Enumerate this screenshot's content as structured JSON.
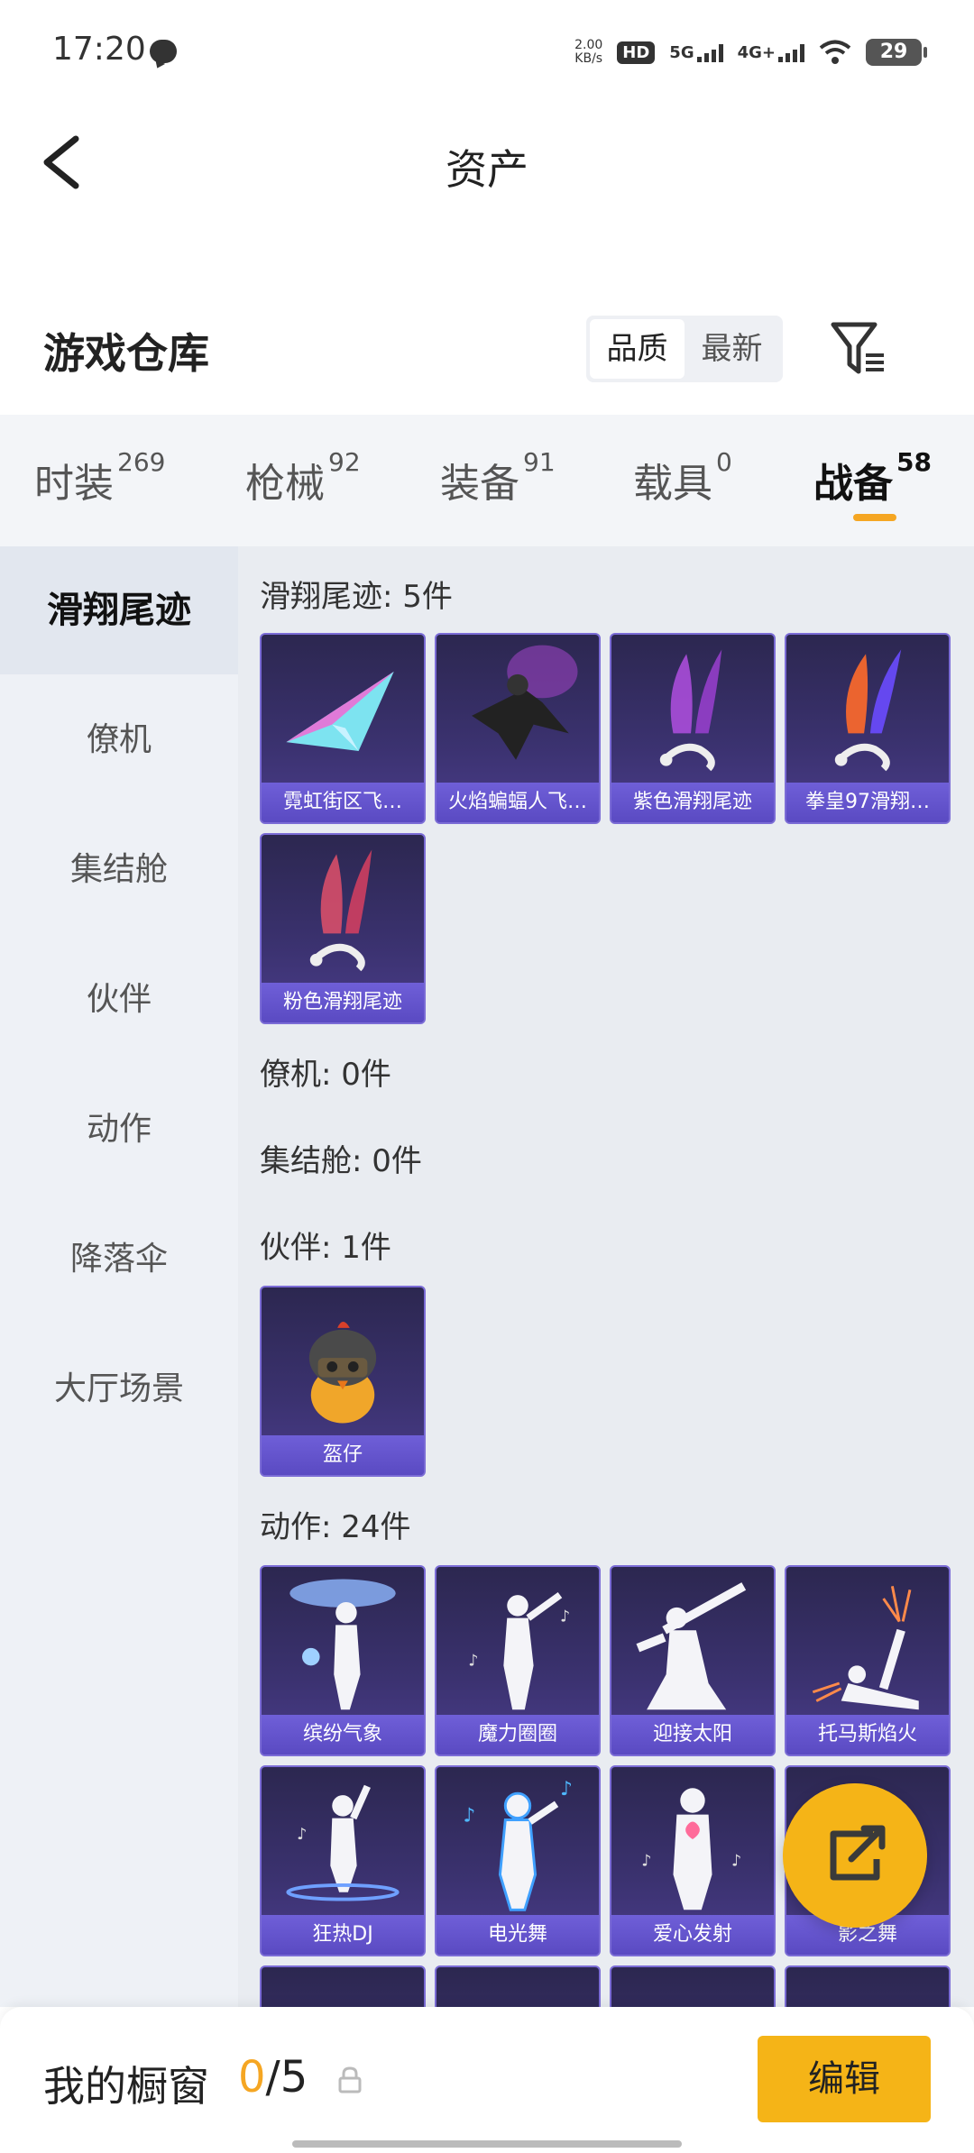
{
  "status_bar": {
    "time": "17:20",
    "speed_value": "2.00",
    "speed_unit": "KB/s",
    "hd": "HD",
    "net1": "5G",
    "net2": "4G+",
    "battery": "29"
  },
  "header": {
    "title": "资产"
  },
  "warehouse": {
    "title": "游戏仓库",
    "sort_options": [
      "品质",
      "最新"
    ],
    "sort_active": "品质"
  },
  "tabs": [
    {
      "label": "时装",
      "count": "269"
    },
    {
      "label": "枪械",
      "count": "92"
    },
    {
      "label": "装备",
      "count": "91"
    },
    {
      "label": "载具",
      "count": "0"
    },
    {
      "label": "战备",
      "count": "58",
      "active": true
    }
  ],
  "sidebar": {
    "items": [
      "滑翔尾迹",
      "僚机",
      "集结舱",
      "伙伴",
      "动作",
      "降落伞",
      "大厅场景"
    ],
    "active": "滑翔尾迹"
  },
  "sections": {
    "glide": {
      "title": "滑翔尾迹: 5件",
      "items": [
        "霓虹街区飞…",
        "火焰蝙蝠人飞…",
        "紫色滑翔尾迹",
        "拳皇97滑翔…",
        "粉色滑翔尾迹"
      ]
    },
    "wingman": {
      "title": "僚机: 0件"
    },
    "pod": {
      "title": "集结舱: 0件"
    },
    "partner": {
      "title": "伙伴: 1件",
      "items": [
        "盔仔"
      ]
    },
    "emote": {
      "title": "动作: 24件",
      "items": [
        "缤纷气象",
        "魔力圈圈",
        "迎接太阳",
        "托马斯焰火",
        "狂热DJ",
        "电光舞",
        "爱心发射",
        "影之舞"
      ]
    }
  },
  "bottom": {
    "label": "我的橱窗",
    "count_current": "0",
    "count_total": "/5",
    "edit_label": "编辑"
  },
  "colors": {
    "accent": "#f5b417",
    "card_bg": "#3b3270",
    "card_border": "#7b6cd6"
  }
}
